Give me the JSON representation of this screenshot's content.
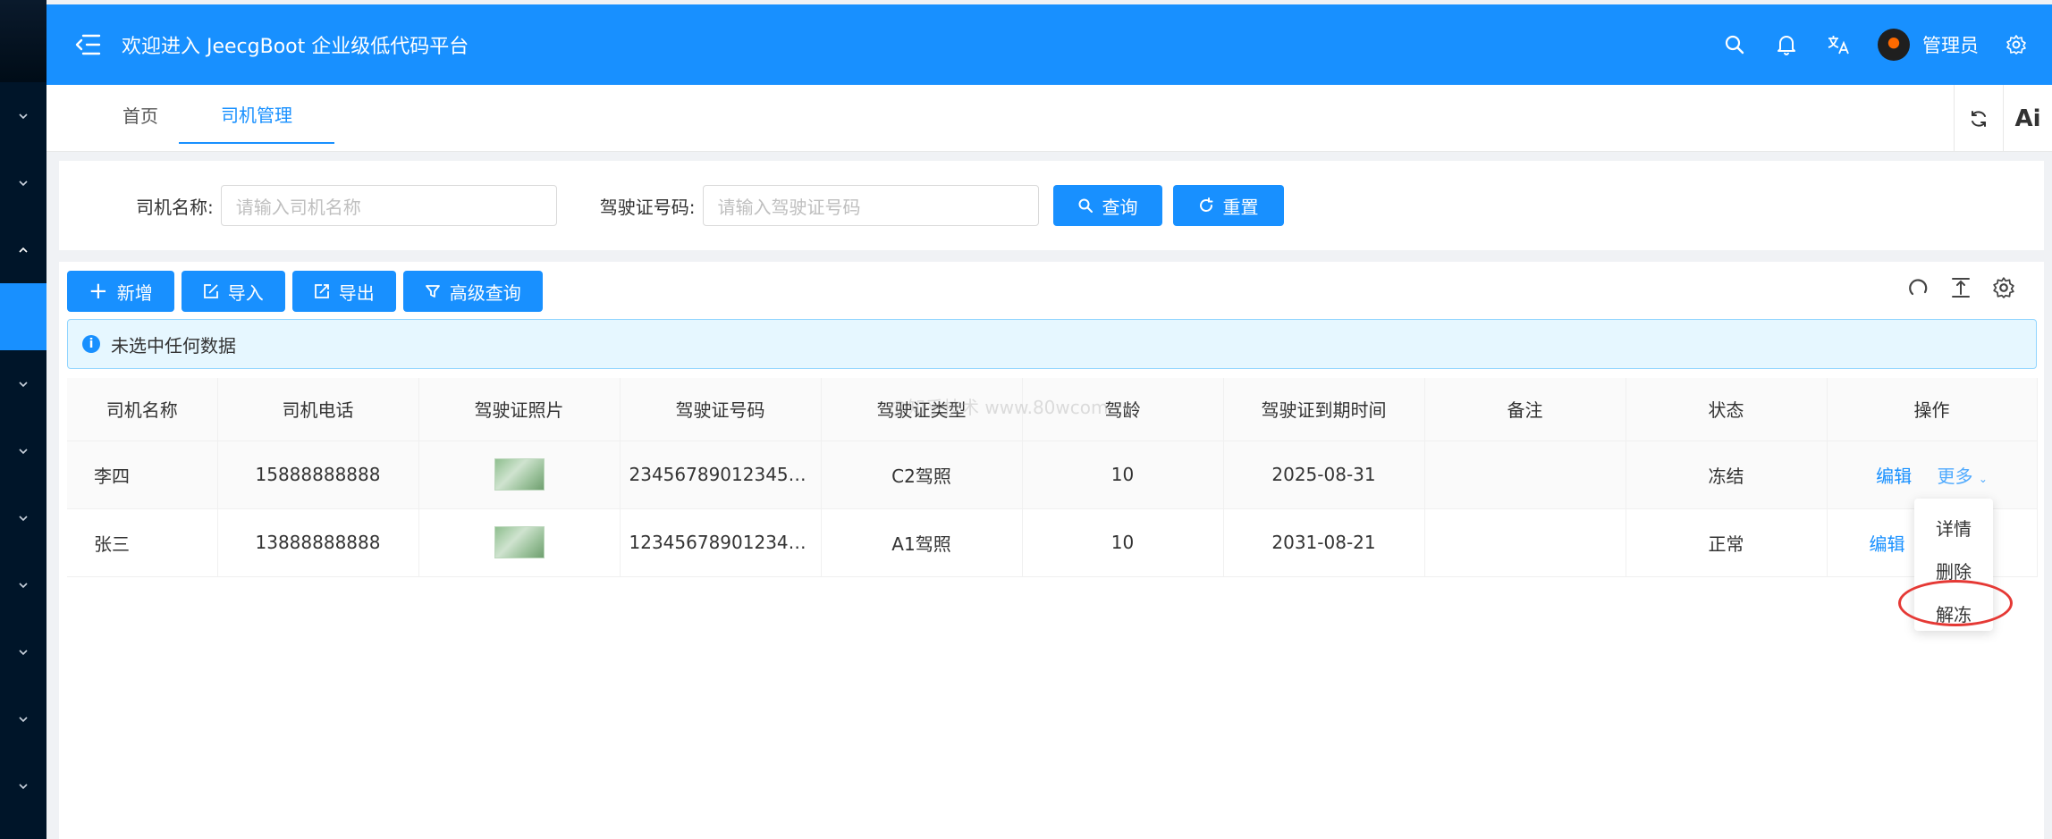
{
  "header": {
    "title": "欢迎进入 JeecgBoot 企业级低代码平台",
    "username": "管理员"
  },
  "tabs": [
    {
      "label": "首页"
    },
    {
      "label": "司机管理"
    }
  ],
  "tabs_right": {
    "ai_label": "Ai"
  },
  "search": {
    "driver_name_label": "司机名称:",
    "driver_name_placeholder": "请输入司机名称",
    "license_no_label": "驾驶证号码:",
    "license_no_placeholder": "请输入驾驶证号码",
    "query_button": "查询",
    "reset_button": "重置"
  },
  "toolbar": {
    "add_button": "新增",
    "import_button": "导入",
    "export_button": "导出",
    "advanced_query_button": "高级查询"
  },
  "alert": {
    "text": "未选中任何数据"
  },
  "table": {
    "columns": [
      "司机名称",
      "司机电话",
      "驾驶证照片",
      "驾驶证号码",
      "驾驶证类型",
      "驾龄",
      "驾驶证到期时间",
      "备注",
      "状态",
      "操作"
    ],
    "rows": [
      {
        "name": "李四",
        "phone": "15888888888",
        "license_no": "2345678901234567...",
        "license_type": "C2驾照",
        "years": "10",
        "expire": "2025-08-31",
        "remark": "",
        "status": "冻结",
        "edit": "编辑",
        "more": "更多"
      },
      {
        "name": "张三",
        "phone": "13888888888",
        "license_no": "1234567890123456...",
        "license_type": "A1驾照",
        "years": "10",
        "expire": "2031-08-21",
        "remark": "",
        "status": "正常",
        "edit": "编辑"
      }
    ]
  },
  "dropdown": {
    "items": [
      "详情",
      "删除",
      "解冻"
    ]
  },
  "watermark": "@知乎技术 www.80wcom"
}
